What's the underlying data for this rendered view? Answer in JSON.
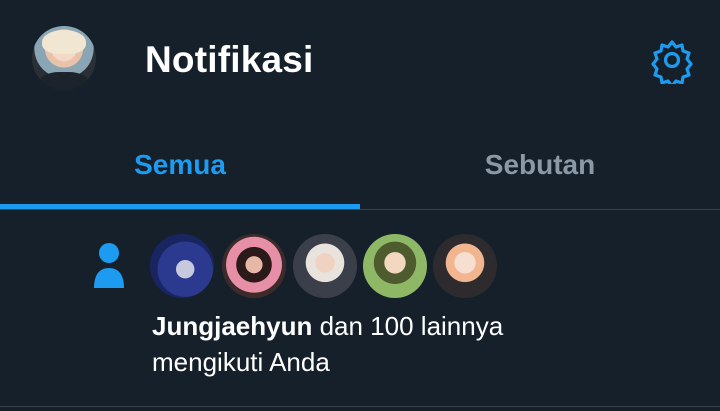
{
  "header": {
    "title": "Notifikasi",
    "profile_avatar": "user-avatar",
    "settings_icon": "gear-icon"
  },
  "tabs": [
    {
      "label": "Semua",
      "active": true
    },
    {
      "label": "Sebutan",
      "active": false
    }
  ],
  "notification": {
    "type_icon": "follow-person-icon",
    "avatars": [
      "avatar-1",
      "avatar-2",
      "avatar-3",
      "avatar-4",
      "avatar-5"
    ],
    "username": "Jungjaehyun",
    "text_rest": " dan 100 lainnya",
    "text_line2": "mengikuti Anda"
  },
  "colors": {
    "background": "#15202b",
    "accent": "#1d9bf0",
    "muted": "#8b98a5",
    "divider": "#38444d",
    "text": "#ffffff"
  }
}
